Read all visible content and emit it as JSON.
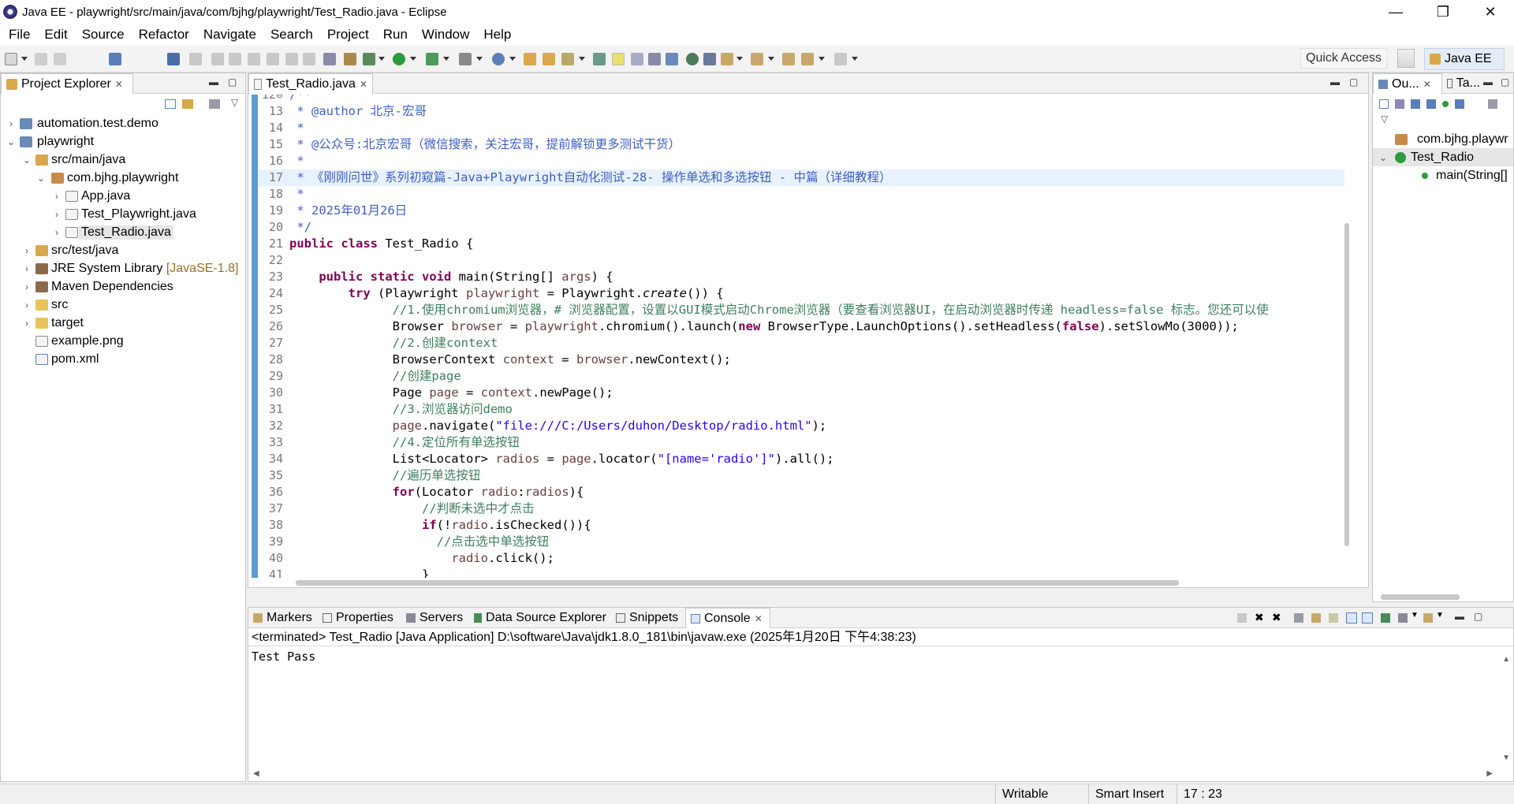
{
  "window": {
    "title": "Java EE - playwright/src/main/java/com/bjhg/playwright/Test_Radio.java - Eclipse",
    "minimize": "—",
    "restore": "❐",
    "close": "✕"
  },
  "menubar": [
    "File",
    "Edit",
    "Source",
    "Refactor",
    "Navigate",
    "Search",
    "Project",
    "Run",
    "Window",
    "Help"
  ],
  "toolbar": {
    "quick_access_placeholder": "Quick Access",
    "perspective": "Java EE"
  },
  "project_explorer": {
    "tab_label": "Project Explorer",
    "items": [
      {
        "label": "automation.test.demo",
        "icon": "project-icon"
      },
      {
        "label": "playwright",
        "icon": "project-icon"
      },
      {
        "label": "src/main/java",
        "icon": "source-folder-icon"
      },
      {
        "label": "com.bjhg.playwright",
        "icon": "package-icon"
      },
      {
        "label": "App.java",
        "icon": "java-file-icon"
      },
      {
        "label": "Test_Playwright.java",
        "icon": "java-file-icon"
      },
      {
        "label": "Test_Radio.java",
        "icon": "java-file-icon"
      },
      {
        "label": "src/test/java",
        "icon": "source-folder-icon"
      },
      {
        "label": "JRE System Library",
        "suffix": "[JavaSE-1.8]",
        "icon": "library-icon"
      },
      {
        "label": "Maven Dependencies",
        "icon": "library-icon"
      },
      {
        "label": "src",
        "icon": "folder-icon"
      },
      {
        "label": "target",
        "icon": "folder-icon"
      },
      {
        "label": "example.png",
        "icon": "image-file-icon"
      },
      {
        "label": "pom.xml",
        "icon": "xml-file-icon"
      }
    ]
  },
  "editor": {
    "tab_label": "Test_Radio.java",
    "line_numbers": [
      "13",
      "14",
      "15",
      "16",
      "17",
      "18",
      "19",
      "20",
      "21",
      "22",
      "23",
      "24",
      "25",
      "26",
      "27",
      "28",
      "29",
      "30",
      "31",
      "32",
      "33",
      "34",
      "35",
      "36",
      "37",
      "38",
      "39",
      "40",
      "41"
    ],
    "lines": {
      "l13": " * @author 北京-宏哥",
      "l14": " *",
      "l15": " * @公众号:北京宏哥（微信搜索，关注宏哥，提前解锁更多测试干货）",
      "l16": " *",
      "l17": " * 《刚刚问世》系列初窥篇-Java+Playwright自动化测试-28- 操作单选和多选按钮 - 中篇（详细教程）",
      "l18": " *",
      "l19": " * 2025年01月26日",
      "l20": " */",
      "l21_kw": "public class",
      "l21_rest": " Test_Radio {",
      "l23_kw": "public static void",
      "l23_rest": " main(String[] ",
      "l23_arg": "args",
      "l23_end": ") {",
      "l24_kw": "try",
      "l24_a": " (Playwright ",
      "l24_var": "playwright",
      "l24_b": " = Playwright.",
      "l24_it": "create",
      "l24_c": "()) {",
      "l25": "//1.使用chromium浏览器，# 浏览器配置，设置以GUI模式启动Chrome浏览器（要查看浏览器UI，在启动浏览器时传递 headless=false 标志。您还可以使",
      "l26_a": "Browser ",
      "l26_var": "browser",
      "l26_b": " = ",
      "l26_var2": "playwright",
      "l26_c": ".chromium().launch(",
      "l26_kw": "new",
      "l26_d": " BrowserType.LaunchOptions().setHeadless(",
      "l26_kw2": "false",
      "l26_e": ").setSlowMo(3000));",
      "l27": "//2.创建context",
      "l28_a": "BrowserContext ",
      "l28_var": "context",
      "l28_b": " = ",
      "l28_var2": "browser",
      "l28_c": ".newContext();",
      "l29": "//创建page",
      "l30_a": "Page ",
      "l30_var": "page",
      "l30_b": " = ",
      "l30_var2": "context",
      "l30_c": ".newPage();",
      "l31": "//3.浏览器访问demo",
      "l32_var": "page",
      "l32_a": ".navigate(",
      "l32_str": "\"file:///C:/Users/duhon/Desktop/radio.html\"",
      "l32_b": ");",
      "l33": "//4.定位所有单选按钮",
      "l34_a": "List<Locator> ",
      "l34_var": "radios",
      "l34_b": " = ",
      "l34_var2": "page",
      "l34_c": ".locator(",
      "l34_str": "\"[name='radio']\"",
      "l34_d": ").all();",
      "l35": "//遍历单选按钮",
      "l36_kw": "for",
      "l36_a": "(Locator ",
      "l36_var": "radio",
      "l36_b": ":",
      "l36_var2": "radios",
      "l36_c": "){",
      "l37": "//判断未选中才点击",
      "l38_kw": "if",
      "l38_a": "(!",
      "l38_var": "radio",
      "l38_b": ".isChecked()){",
      "l39": "//点击选中单选按钮",
      "l40_var": "radio",
      "l40_a": ".click();",
      "l41": "}"
    }
  },
  "outline": {
    "tab1": "Ou...",
    "tab2": "Ta...",
    "items": [
      "com.bjhg.playwr",
      "Test_Radio",
      "main(String[]"
    ]
  },
  "console": {
    "tabs": [
      "Markers",
      "Properties",
      "Servers",
      "Data Source Explorer",
      "Snippets",
      "Console"
    ],
    "header": "<terminated> Test_Radio [Java Application] D:\\software\\Java\\jdk1.8.0_181\\bin\\javaw.exe (2025年1月20日 下午4:38:23)",
    "output": "Test Pass"
  },
  "statusbar": {
    "writable": "Writable",
    "insert_mode": "Smart Insert",
    "position": "17 : 23"
  },
  "colors": {
    "keyword": "#7f0055",
    "comment": "#3f7f5f",
    "javadoc": "#3f5fbf",
    "string": "#2a00ff",
    "field": "#6a3e3e",
    "selection": "#e8f2fe"
  }
}
